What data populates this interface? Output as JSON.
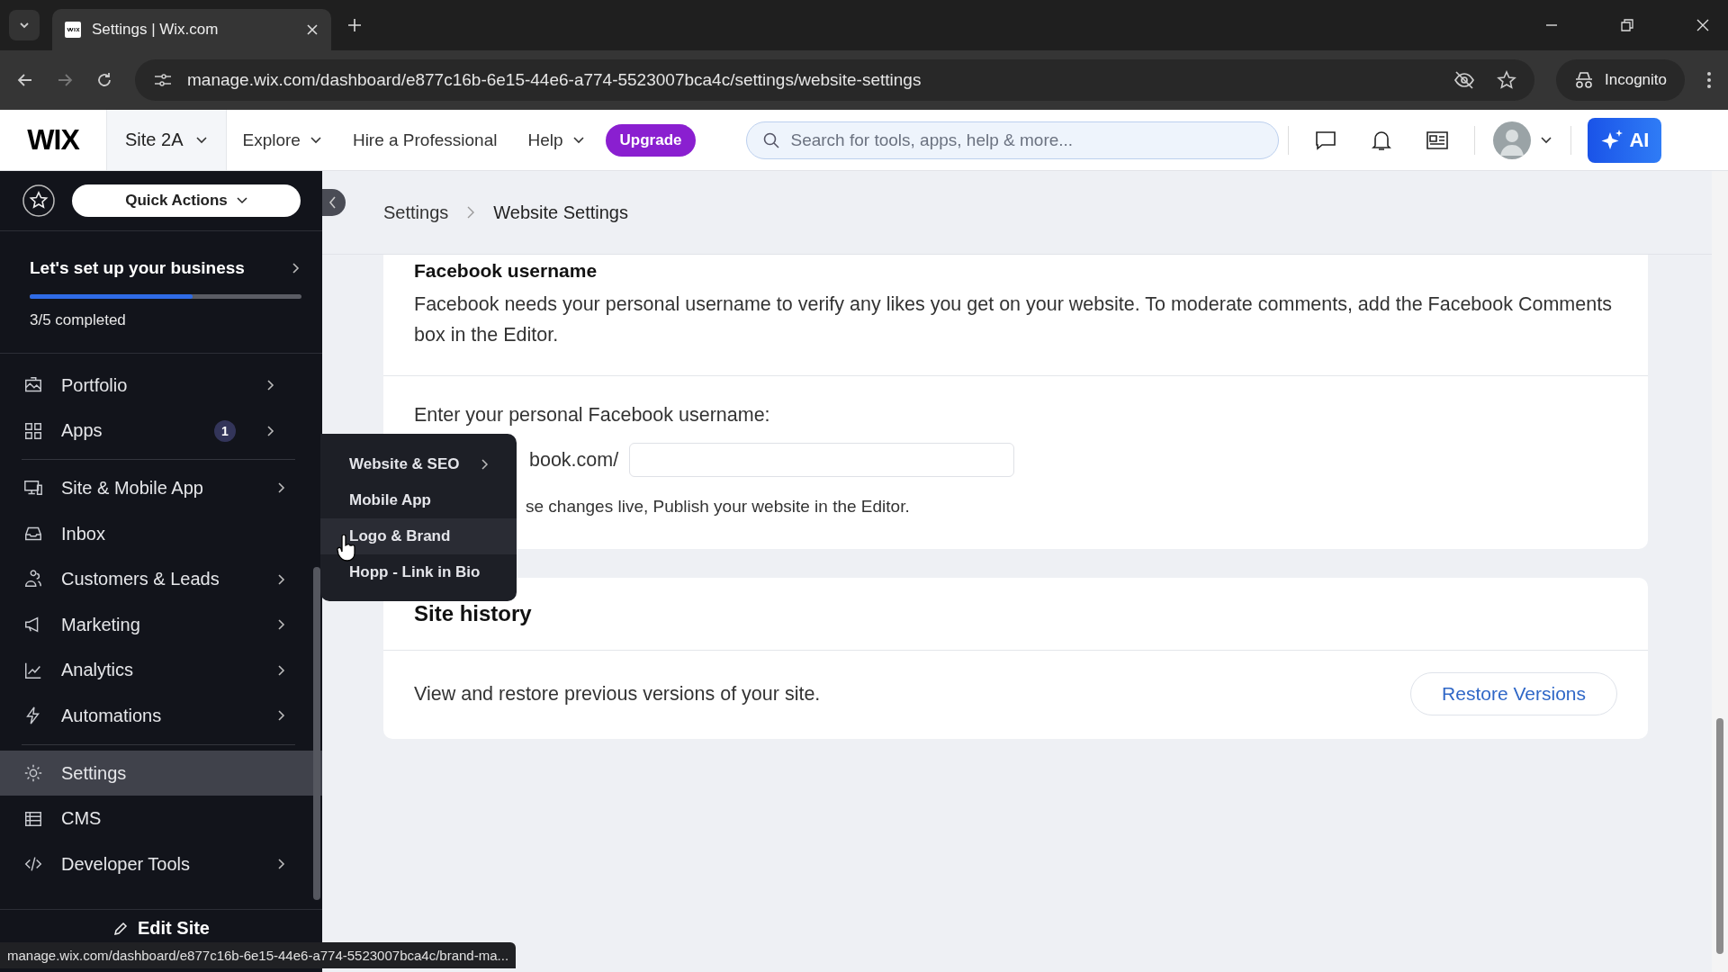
{
  "browser": {
    "tab_title": "Settings | Wix.com",
    "url": "manage.wix.com/dashboard/e877c16b-6e15-44e6-a774-5523007bca4c/settings/website-settings",
    "profile": "Incognito"
  },
  "header": {
    "logo": "WIX",
    "site": "Site 2A",
    "nav": [
      {
        "label": "Explore",
        "dropdown": true
      },
      {
        "label": "Hire a Professional",
        "dropdown": false
      },
      {
        "label": "Help",
        "dropdown": true
      }
    ],
    "upgrade": "Upgrade",
    "search": {
      "placeholder": "Search for tools, apps, help & more..."
    },
    "ai": "AI"
  },
  "sidebar": {
    "quick_actions": "Quick Actions",
    "setup": {
      "title": "Let's set up your business",
      "level": 0.6,
      "status": "3/5 completed"
    },
    "sections": [
      {
        "items": [
          {
            "label": "Portfolio",
            "arrow": true,
            "selected": false
          },
          {
            "label": "Apps",
            "badge": "1",
            "arrow": true,
            "selected": false
          }
        ]
      },
      {
        "items": [
          {
            "label": "Site & Mobile App",
            "arrow": true,
            "selected": false
          },
          {
            "label": "Inbox",
            "arrow": false,
            "selected": false
          },
          {
            "label": "Customers & Leads",
            "arrow": true,
            "selected": false
          },
          {
            "label": "Marketing",
            "arrow": true,
            "selected": false
          },
          {
            "label": "Analytics",
            "arrow": true,
            "selected": false
          },
          {
            "label": "Automations",
            "arrow": true,
            "selected": false
          }
        ]
      },
      {
        "items": [
          {
            "label": "Settings",
            "arrow": false,
            "selected": true
          },
          {
            "label": "CMS",
            "arrow": false,
            "selected": false
          },
          {
            "label": "Developer Tools",
            "arrow": true,
            "selected": false
          }
        ]
      }
    ],
    "edit_site": "Edit Site"
  },
  "submenu": [
    {
      "label": "Website & SEO",
      "arrow": true,
      "hovered": false
    },
    {
      "label": "Mobile App",
      "arrow": false,
      "hovered": false
    },
    {
      "label": "Logo & Brand",
      "arrow": false,
      "hovered": true
    },
    {
      "label": "Hopp - Link in Bio",
      "arrow": false,
      "hovered": false
    }
  ],
  "breadcrumb": [
    "Settings",
    "Website Settings"
  ],
  "facebook": {
    "heading": "Facebook username",
    "description": "Facebook needs your personal username to verify any likes you get on your website. To moderate comments, add the Facebook Comments box in the Editor.",
    "field_label": "Enter your personal Facebook username:",
    "prefix": "book.com/",
    "hint": "se changes live, Publish your website in the Editor."
  },
  "site_history": {
    "heading": "Site history",
    "text": "View and restore previous versions of your site.",
    "button": "Restore Versions"
  },
  "status_url": "manage.wix.com/dashboard/e877c16b-6e15-44e6-a774-5523007bca4c/brand-ma..."
}
